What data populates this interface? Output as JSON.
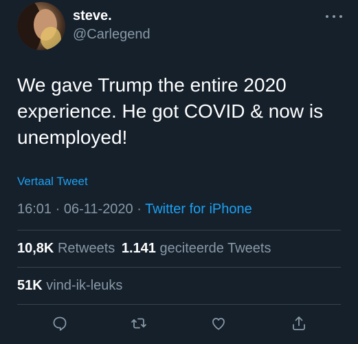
{
  "tweet": {
    "display_name": "steve.",
    "handle": "@Carlegend",
    "text": "We gave Trump the entire 2020 experience. He got COVID & now is unemployed!",
    "translate_label": "Vertaal Tweet",
    "time": "16:01",
    "separator": "·",
    "date": "06-11-2020",
    "source": "Twitter for iPhone"
  },
  "stats": {
    "retweets_count": "10,8K",
    "retweets_label": "Retweets",
    "quotes_count": "1.141",
    "quotes_label": "geciteerde Tweets",
    "likes_count": "51K",
    "likes_label": "vind-ik-leuks"
  },
  "actions": [
    "reply-icon",
    "retweet-icon",
    "like-icon",
    "share-icon"
  ],
  "colors": {
    "background": "#15202b",
    "text": "#ffffff",
    "secondary": "#8899a6",
    "link": "#1da1f2",
    "divider": "#38444d"
  }
}
